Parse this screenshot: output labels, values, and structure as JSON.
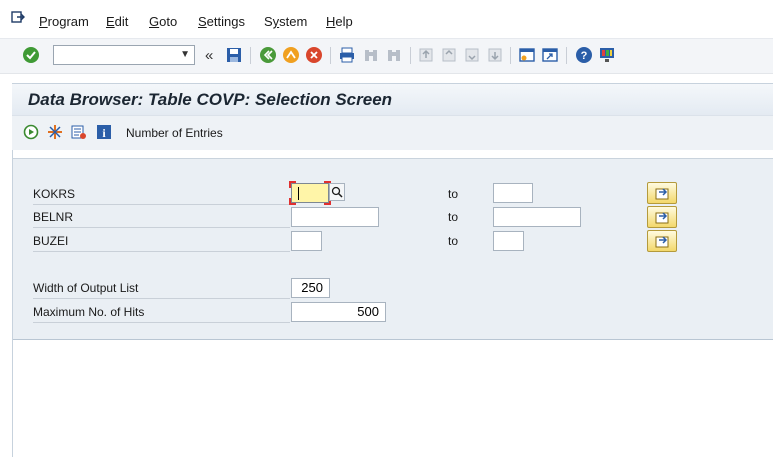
{
  "menu": {
    "items": [
      {
        "label": "Program",
        "mnemonic": "P",
        "rest": "rogram"
      },
      {
        "label": "Edit",
        "mnemonic": "E",
        "rest": "dit"
      },
      {
        "label": "Goto",
        "mnemonic": "G",
        "rest": "oto"
      },
      {
        "label": "Settings",
        "mnemonic": "S",
        "rest": "ettings"
      },
      {
        "label": "System",
        "mnemonic": "y",
        "pre": "S",
        "rest": "stem"
      },
      {
        "label": "Help",
        "mnemonic": "H",
        "rest": "elp"
      }
    ]
  },
  "toolbar": {
    "command_field_value": "",
    "back_arrows": "«"
  },
  "title": "Data Browser: Table COVP: Selection Screen",
  "app_toolbar": {
    "number_of_entries": "Number of Entries"
  },
  "selection": {
    "rows": [
      {
        "label": "KOKRS",
        "low": "",
        "to": "to",
        "high": ""
      },
      {
        "label": "BELNR",
        "low": "",
        "to": "to",
        "high": ""
      },
      {
        "label": "BUZEI",
        "low": "",
        "to": "to",
        "high": ""
      }
    ],
    "width_label": "Width of Output List",
    "width_value": "250",
    "max_hits_label": "Maximum No. of Hits",
    "max_hits_value": "500"
  },
  "colors": {
    "title_band": "#e3eaf2",
    "selection_bg": "#eaeff4",
    "focus_field": "#fff5a8",
    "multiple_selection_button": "#f3d86b"
  }
}
